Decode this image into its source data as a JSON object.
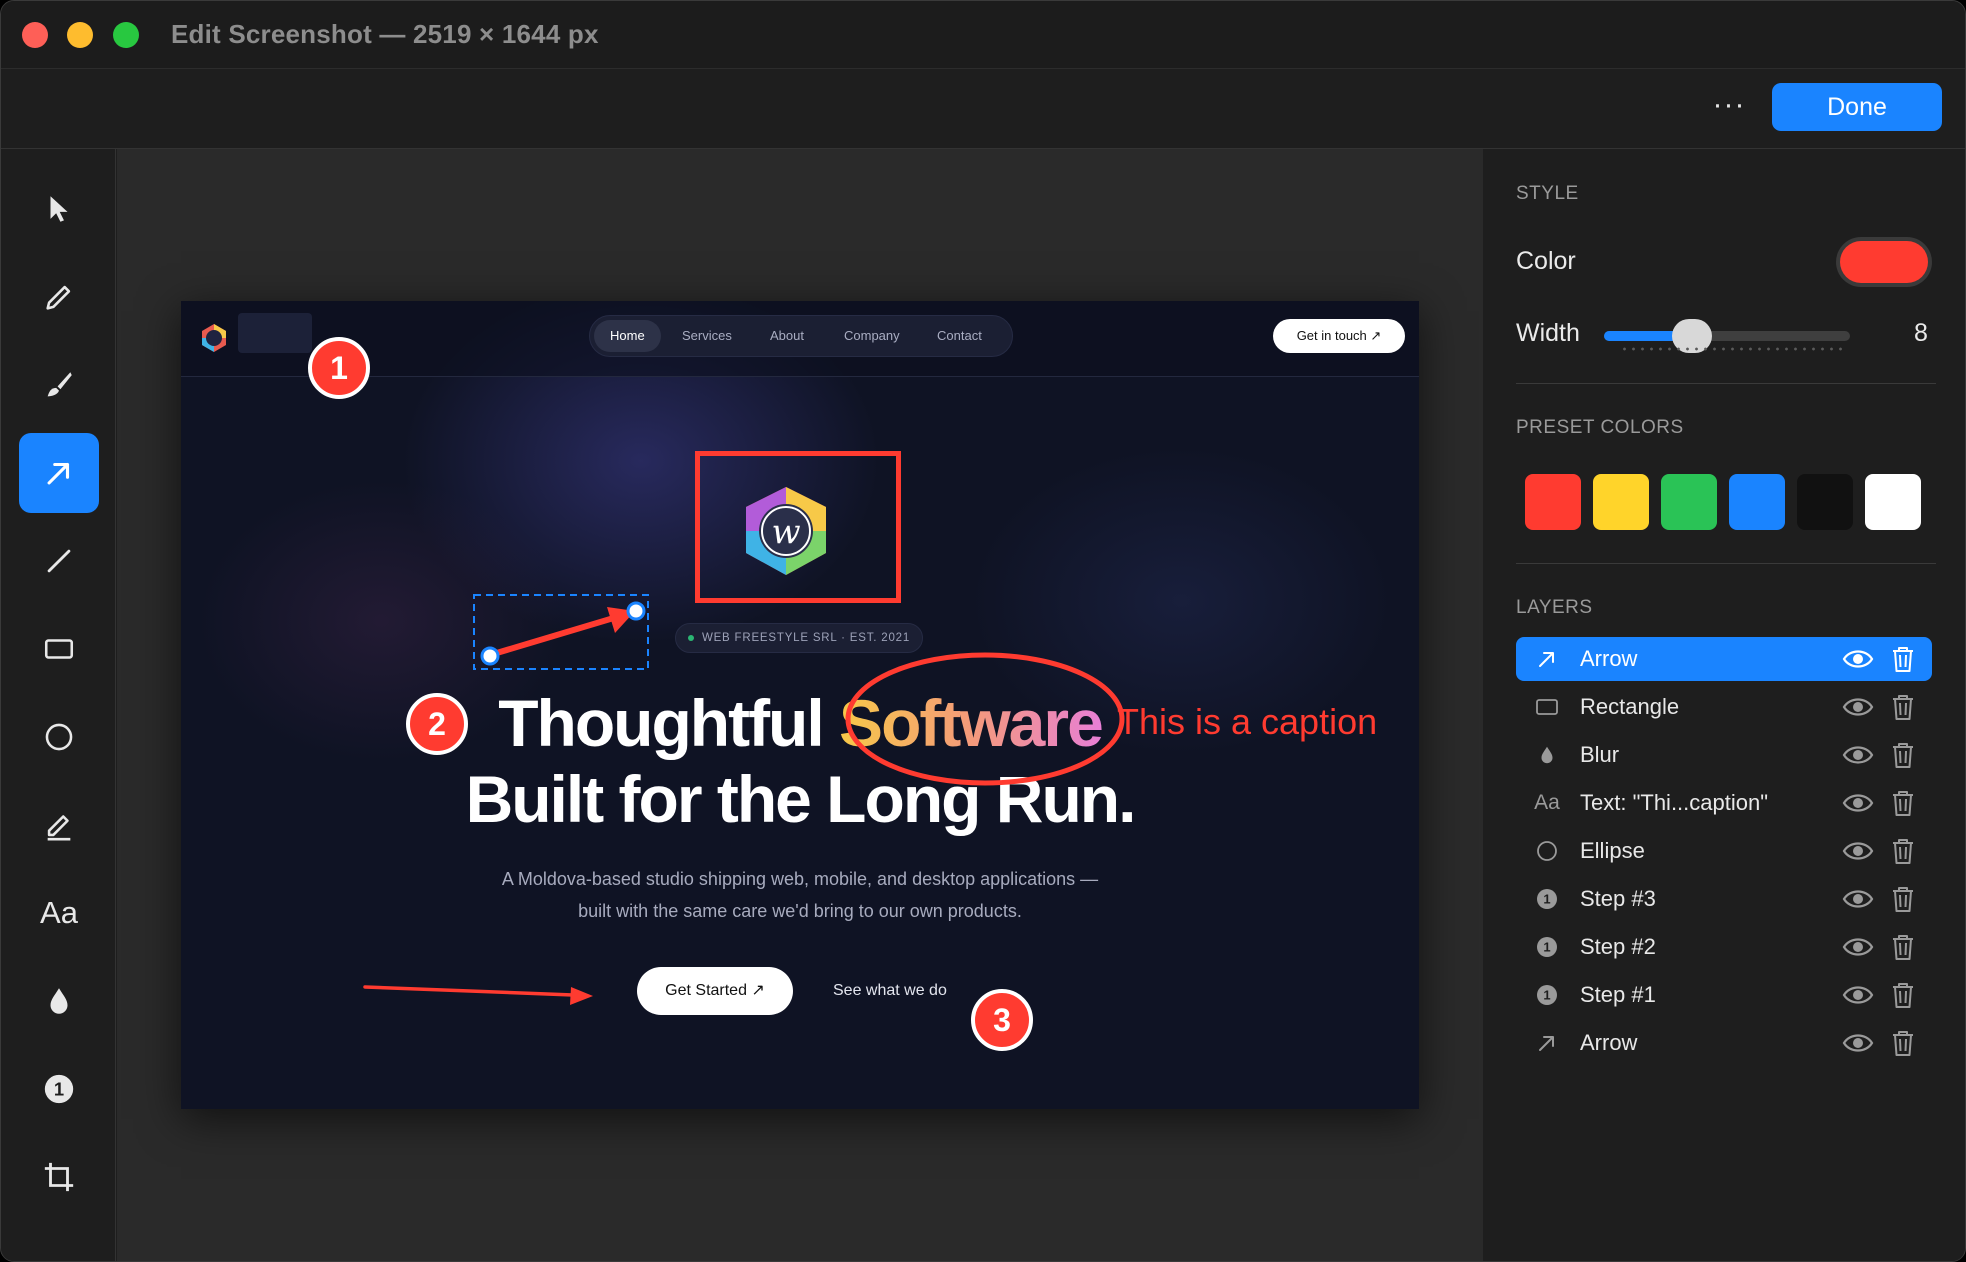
{
  "window": {
    "title": "Edit Screenshot — 2519 × 1644 px"
  },
  "toolbar": {
    "more_label": "···",
    "done_label": "Done"
  },
  "tools": [
    {
      "name": "select-tool",
      "icon": "cursor-icon"
    },
    {
      "name": "pen-tool",
      "icon": "pencil-icon"
    },
    {
      "name": "brush-tool",
      "icon": "brush-icon"
    },
    {
      "name": "arrow-tool",
      "icon": "arrow-icon",
      "active": true
    },
    {
      "name": "line-tool",
      "icon": "line-icon"
    },
    {
      "name": "rectangle-tool",
      "icon": "rectangle-icon"
    },
    {
      "name": "ellipse-tool",
      "icon": "ellipse-icon"
    },
    {
      "name": "highlighter-tool",
      "icon": "highlighter-icon"
    },
    {
      "name": "text-tool",
      "icon": "text-icon",
      "label": "Aa"
    },
    {
      "name": "blur-tool",
      "icon": "drop-icon"
    },
    {
      "name": "step-tool",
      "icon": "step-number-icon",
      "label": "1"
    },
    {
      "name": "crop-tool",
      "icon": "crop-icon"
    }
  ],
  "screenshot": {
    "nav": {
      "items": [
        "Home",
        "Services",
        "About",
        "Company",
        "Contact"
      ],
      "cta": "Get in touch ↗"
    },
    "badge": "WEB FREESTYLE SRL · EST. 2021",
    "headline_part1": "Thoughtful ",
    "headline_highlight": "Software",
    "headline_line2": "Built for the Long Run.",
    "subtitle_line1": "A Moldova-based studio shipping web, mobile, and desktop applications —",
    "subtitle_line2": "built with the same care we'd bring to our own products.",
    "cta_primary": "Get Started ↗",
    "cta_secondary": "See what we do"
  },
  "annotations": {
    "caption": "This is a caption",
    "steps": [
      "1",
      "2",
      "3"
    ],
    "color": "#ff3b30"
  },
  "style_panel": {
    "section_style": "STYLE",
    "color_label": "Color",
    "color_value": "#ff3b30",
    "width_label": "Width",
    "width_value": "8",
    "width_fraction": 0.33,
    "section_presets": "PRESET COLORS",
    "presets": [
      "#ff3b30",
      "#ffd42a",
      "#2ac356",
      "#1a84ff",
      "#111111",
      "#ffffff"
    ],
    "section_layers": "LAYERS",
    "layers": [
      {
        "label": "Arrow",
        "icon": "arrow-icon",
        "selected": true
      },
      {
        "label": "Rectangle",
        "icon": "rectangle-icon"
      },
      {
        "label": "Blur",
        "icon": "drop-icon"
      },
      {
        "label": "Text: \"Thi...caption\"",
        "icon": "text-icon"
      },
      {
        "label": "Ellipse",
        "icon": "ellipse-icon"
      },
      {
        "label": "Step #3",
        "icon": "step-number-icon"
      },
      {
        "label": "Step #2",
        "icon": "step-number-icon"
      },
      {
        "label": "Step #1",
        "icon": "step-number-icon"
      },
      {
        "label": "Arrow",
        "icon": "arrow-icon"
      }
    ]
  },
  "accent_color": "#1a84ff"
}
